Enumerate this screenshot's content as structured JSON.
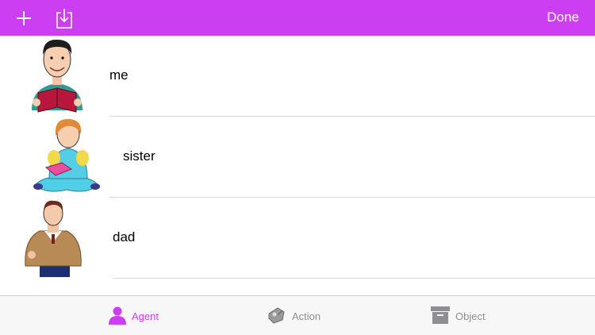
{
  "navbar": {
    "done_label": "Done",
    "add_icon": "plus-icon",
    "import_icon": "import-icon",
    "background": "#cc3ef2"
  },
  "list": {
    "items": [
      {
        "label": "me",
        "image": "boy-reading-book"
      },
      {
        "label": "sister",
        "image": "girl-reading-book"
      },
      {
        "label": "dad",
        "image": "man-in-sweater"
      }
    ]
  },
  "tabs": [
    {
      "label": "Agent",
      "icon": "person-icon",
      "selected": true
    },
    {
      "label": "Action",
      "icon": "action-icon",
      "selected": false
    },
    {
      "label": "Object",
      "icon": "box-icon",
      "selected": false
    }
  ],
  "colors": {
    "accent": "#cc3ef2",
    "tab_inactive": "#8e8e93"
  }
}
